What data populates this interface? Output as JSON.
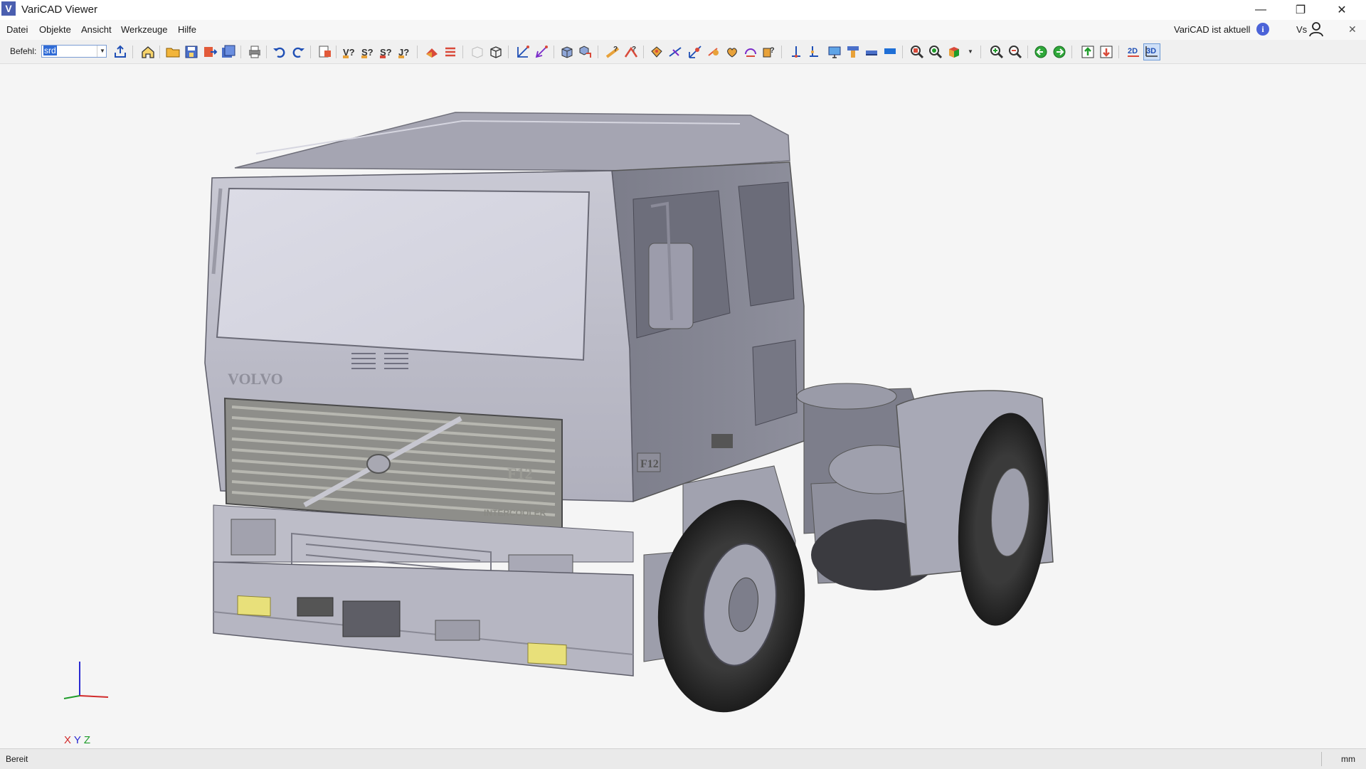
{
  "window": {
    "title": "VariCAD Viewer",
    "logo": "V"
  },
  "menu": {
    "items": [
      "Datei",
      "Objekte",
      "Ansicht",
      "Werkzeuge",
      "Hilfe"
    ],
    "status_text": "VariCAD ist aktuell",
    "user_label": "Vs"
  },
  "toolbar": {
    "command_label": "Befehl:",
    "command_value": "srd"
  },
  "axes": {
    "x": "X",
    "y": "Y",
    "z": "Z"
  },
  "truck_labels": {
    "brand": "VOLVO",
    "model": "F12",
    "intercooler": "INTERCOOLER"
  },
  "statusbar": {
    "status": "Bereit",
    "units": "mm"
  },
  "colors": {
    "accent": "#2f6bd6",
    "info": "#4b63d8",
    "axis_x": "#d12a2a",
    "axis_y": "#2a2ad1",
    "axis_z": "#1f9c2a"
  }
}
